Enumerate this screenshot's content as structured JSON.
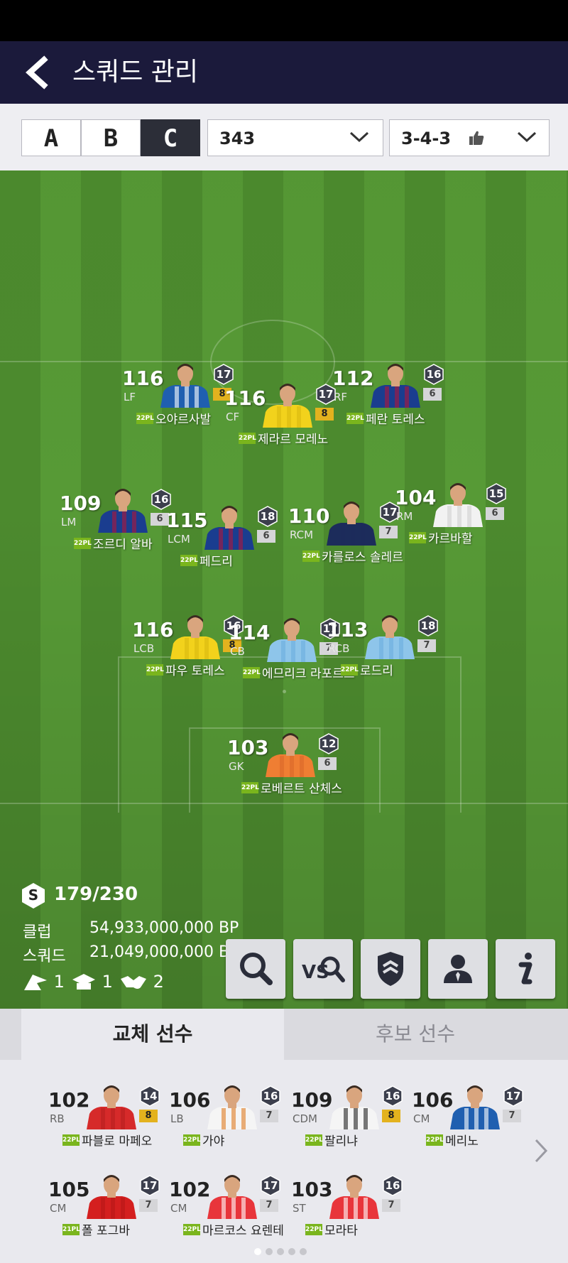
{
  "header": {
    "title": "스쿼드 관리"
  },
  "squad_tabs": [
    "A",
    "B",
    "C"
  ],
  "active_squad_tab": "C",
  "formation_select": "343",
  "tactic_select": "3-4-3",
  "players": [
    {
      "ovr": "116",
      "pos": "LF",
      "grade": "17",
      "level": "8",
      "level_color": "gold",
      "badge": "22PL",
      "name": "오야르사발",
      "jersey": "#1f5fb0",
      "jersey2": "#ffffff"
    },
    {
      "ovr": "116",
      "pos": "CF",
      "grade": "17",
      "level": "8",
      "level_color": "gold",
      "badge": "22PL",
      "name": "제라르 모레노",
      "jersey": "#f2d21c",
      "jersey2": "#d9b90f"
    },
    {
      "ovr": "112",
      "pos": "RF",
      "grade": "16",
      "level": "6",
      "level_color": "grey",
      "badge": "22PL",
      "name": "페란 토레스",
      "jersey": "#1a3d8f",
      "jersey2": "#b0163a"
    },
    {
      "ovr": "109",
      "pos": "LM",
      "grade": "16",
      "level": "6",
      "level_color": "grey",
      "badge": "22PL",
      "name": "조르디 알바",
      "jersey": "#1a3d8f",
      "jersey2": "#b0163a"
    },
    {
      "ovr": "115",
      "pos": "LCM",
      "grade": "18",
      "level": "6",
      "level_color": "grey",
      "badge": "22PL",
      "name": "페드리",
      "jersey": "#1a3d8f",
      "jersey2": "#b0163a"
    },
    {
      "ovr": "110",
      "pos": "RCM",
      "grade": "17",
      "level": "7",
      "level_color": "grey",
      "badge": "22PL",
      "name": "카를로스 솔레르",
      "jersey": "#1c2c5b",
      "jersey2": "#1c2c5b"
    },
    {
      "ovr": "104",
      "pos": "RM",
      "grade": "15",
      "level": "6",
      "level_color": "grey",
      "badge": "22PL",
      "name": "카르바할",
      "jersey": "#f2f2f2",
      "jersey2": "#d0d0d0"
    },
    {
      "ovr": "116",
      "pos": "LCB",
      "grade": "16",
      "level": "8",
      "level_color": "gold",
      "badge": "22PL",
      "name": "파우 토레스",
      "jersey": "#f2d21c",
      "jersey2": "#d9b90f"
    },
    {
      "ovr": "114",
      "pos": "CB",
      "grade": "17",
      "level": "7",
      "level_color": "grey",
      "badge": "22PL",
      "name": "에므리크 라포르트",
      "jersey": "#8ec5ea",
      "jersey2": "#6aaedd"
    },
    {
      "ovr": "113",
      "pos": "RCB",
      "grade": "18",
      "level": "7",
      "level_color": "grey",
      "badge": "22PL",
      "name": "로드리",
      "jersey": "#8ec5ea",
      "jersey2": "#6aaedd"
    },
    {
      "ovr": "103",
      "pos": "GK",
      "grade": "12",
      "level": "6",
      "level_color": "grey",
      "badge": "22PL",
      "name": "로베르트 산체스",
      "jersey": "#ef7e33",
      "jersey2": "#d9682a"
    }
  ],
  "stats": {
    "salary_badge": "S",
    "salary_cap": "179/230",
    "club_label": "클럽",
    "club_value": "54,933,000,000 BP",
    "squad_label": "스쿼드",
    "squad_value": "21,049,000,000 BP",
    "counters": [
      "1",
      "1",
      "2"
    ]
  },
  "action_buttons": [
    "search",
    "vs-compare",
    "team-shield",
    "manager",
    "info"
  ],
  "bottom_tabs": {
    "active": "교체 선수",
    "inactive": "후보 선수"
  },
  "substitutes": [
    {
      "ovr": "102",
      "pos": "RB",
      "grade": "14",
      "level": "8",
      "level_color": "gold",
      "badge": "22PL",
      "name": "파블로 마페오",
      "jersey": "#d62a2a",
      "jersey2": "#b51f1f"
    },
    {
      "ovr": "106",
      "pos": "LB",
      "grade": "16",
      "level": "7",
      "level_color": "grey",
      "badge": "22PL",
      "name": "가야",
      "jersey": "#f5f5f5",
      "jersey2": "#e07b22"
    },
    {
      "ovr": "109",
      "pos": "CDM",
      "grade": "16",
      "level": "8",
      "level_color": "gold",
      "badge": "22PL",
      "name": "팔리냐",
      "jersey": "#f5f5f5",
      "jersey2": "#222222"
    },
    {
      "ovr": "106",
      "pos": "CM",
      "grade": "17",
      "level": "7",
      "level_color": "grey",
      "badge": "22PL",
      "name": "메리노",
      "jersey": "#1f5fb0",
      "jersey2": "#ffffff"
    },
    {
      "ovr": "105",
      "pos": "CM",
      "grade": "17",
      "level": "7",
      "level_color": "grey",
      "badge": "21PL",
      "name": "폴 포그바",
      "jersey": "#d41f1f",
      "jersey2": "#b51818"
    },
    {
      "ovr": "102",
      "pos": "CM",
      "grade": "17",
      "level": "7",
      "level_color": "grey",
      "badge": "22PL",
      "name": "마르코스 요렌테",
      "jersey": "#e8353b",
      "jersey2": "#ffffff"
    },
    {
      "ovr": "103",
      "pos": "ST",
      "grade": "16",
      "level": "7",
      "level_color": "grey",
      "badge": "22PL",
      "name": "모라타",
      "jersey": "#e8353b",
      "jersey2": "#ffffff"
    }
  ],
  "page_dots": 5,
  "active_page_dot": 1
}
